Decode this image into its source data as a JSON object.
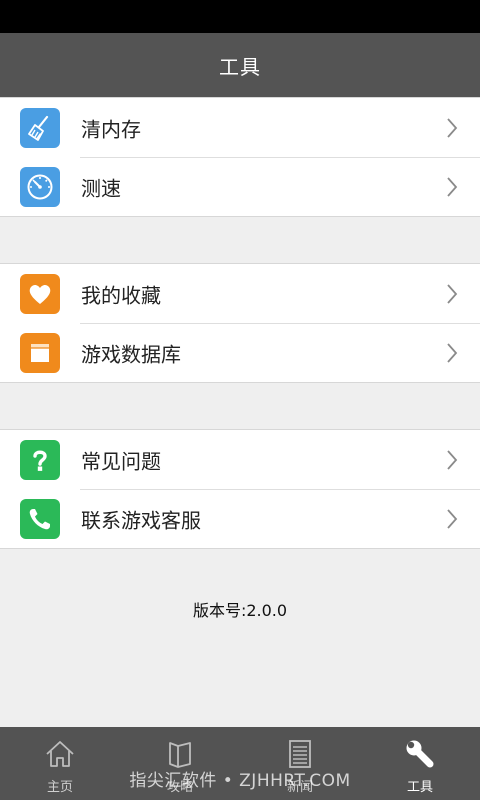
{
  "header": {
    "title": "工具"
  },
  "colors": {
    "clean": "#4a9ee3",
    "speed": "#4a9ee3",
    "favorites": "#f08a1c",
    "database": "#f08a1c",
    "faq": "#2bb958",
    "contact": "#2bb958"
  },
  "groups": [
    {
      "items": [
        {
          "label": "清内存",
          "icon": "broom-icon"
        },
        {
          "label": "测速",
          "icon": "speedometer-icon"
        }
      ]
    },
    {
      "items": [
        {
          "label": "我的收藏",
          "icon": "heart-icon"
        },
        {
          "label": "游戏数据库",
          "icon": "database-box-icon"
        }
      ]
    },
    {
      "items": [
        {
          "label": "常见问题",
          "icon": "question-icon"
        },
        {
          "label": "联系游戏客服",
          "icon": "phone-icon"
        }
      ]
    }
  ],
  "version_text": "版本号:2.0.0",
  "tabs": [
    {
      "label": "主页",
      "icon": "home-icon"
    },
    {
      "label": "攻略",
      "icon": "book-icon"
    },
    {
      "label": "新闻",
      "icon": "news-icon"
    },
    {
      "label": "工具",
      "icon": "wrench-icon",
      "active": true
    }
  ],
  "watermark": "指尖汇软件 • ZJHHRT.COM"
}
